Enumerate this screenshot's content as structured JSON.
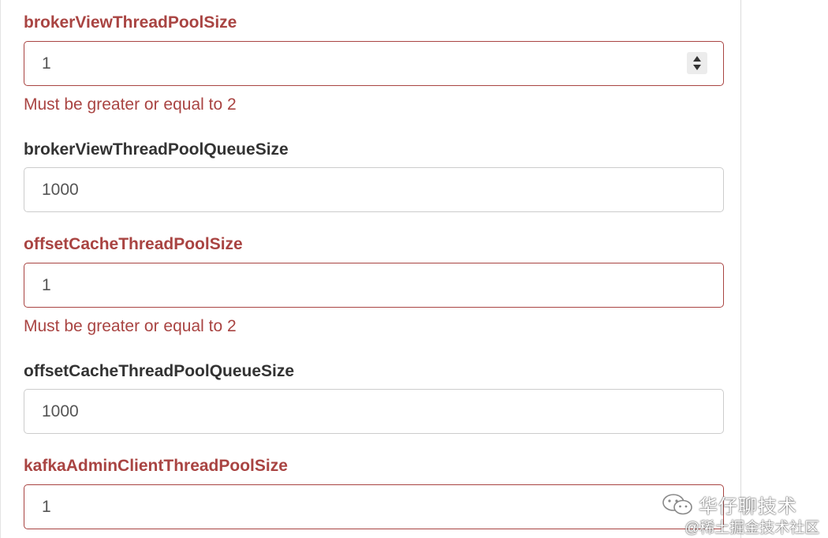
{
  "form": {
    "fields": [
      {
        "label": "brokerViewThreadPoolSize",
        "value": "1",
        "error": "Must be greater or equal to 2",
        "has_error": true
      },
      {
        "label": "brokerViewThreadPoolQueueSize",
        "value": "1000",
        "error": "",
        "has_error": false
      },
      {
        "label": "offsetCacheThreadPoolSize",
        "value": "1",
        "error": "Must be greater or equal to 2",
        "has_error": true
      },
      {
        "label": "offsetCacheThreadPoolQueueSize",
        "value": "1000",
        "error": "",
        "has_error": false
      },
      {
        "label": "kafkaAdminClientThreadPoolSize",
        "value": "1",
        "error": "",
        "has_error": true
      }
    ]
  },
  "watermark": {
    "title": "华仔聊技术",
    "subtitle": "@稀土掘金技术社区",
    "icon": "wechat-icon"
  },
  "colors": {
    "error": "#a94442",
    "label": "#333333",
    "border": "#cccccc"
  }
}
